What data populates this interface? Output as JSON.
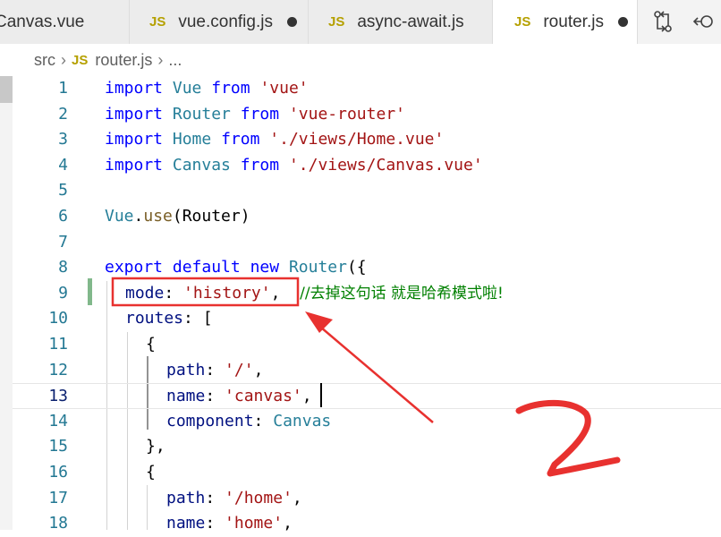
{
  "tabs": [
    {
      "label": "Canvas.vue",
      "icon": "vue-file-icon",
      "dirty": false,
      "active": false
    },
    {
      "label": "vue.config.js",
      "icon": "js-file-icon",
      "dirty": true,
      "active": false
    },
    {
      "label": "async-await.js",
      "icon": "js-file-icon",
      "dirty": false,
      "active": false
    },
    {
      "label": "router.js",
      "icon": "js-file-icon",
      "dirty": true,
      "active": true
    }
  ],
  "js_badge": "JS",
  "actions": [
    {
      "name": "compare-changes-icon"
    },
    {
      "name": "open-changes-icon"
    }
  ],
  "breadcrumb": {
    "folder": "src",
    "file": "router.js",
    "more": "..."
  },
  "lines": [
    {
      "no": "1"
    },
    {
      "no": "2"
    },
    {
      "no": "3"
    },
    {
      "no": "4"
    },
    {
      "no": "5"
    },
    {
      "no": "6"
    },
    {
      "no": "7"
    },
    {
      "no": "8"
    },
    {
      "no": "9"
    },
    {
      "no": "10"
    },
    {
      "no": "11"
    },
    {
      "no": "12"
    },
    {
      "no": "13"
    },
    {
      "no": "14"
    },
    {
      "no": "15"
    },
    {
      "no": "16"
    },
    {
      "no": "17"
    },
    {
      "no": "18"
    }
  ],
  "tokens": {
    "import": "import",
    "from": "from",
    "vue_cls": "Vue",
    "vue_str": "'vue'",
    "router_cls": "Router",
    "router_str": "'vue-router'",
    "home_cls": "Home",
    "home_str": "'./views/Home.vue'",
    "canvas_cls": "Canvas",
    "canvas_str": "'./views/Canvas.vue'",
    "vue_use_obj": "Vue",
    "dot": ".",
    "use_fn": "use",
    "use_args": "(Router)",
    "export": "export",
    "default": "default",
    "new": "new",
    "router_new": "Router",
    "router_open": "({",
    "mode_key": "mode",
    "colon": ": ",
    "mode_val": "'history'",
    "comma": ",",
    "comment": "//去掉这句话 就是哈希模式啦!",
    "routes_key": "routes",
    "routes_open": ": [",
    "brace_open": "{",
    "brace_close_comma": "},",
    "path_key": "path",
    "path_val1": "'/'",
    "name_key": "name",
    "name_val1": "'canvas'",
    "component_key": "component",
    "component_val": "Canvas",
    "path_val2": "'/home'",
    "name_val2": "'home'"
  },
  "annotation": {
    "handwritten": "2",
    "color": "#e8312f"
  },
  "colors": {
    "keyword": "#0000ff",
    "string": "#a31515",
    "property": "#001080",
    "class": "#267f99",
    "comment": "#008000",
    "function": "#795e26",
    "line_number": "#237893"
  }
}
